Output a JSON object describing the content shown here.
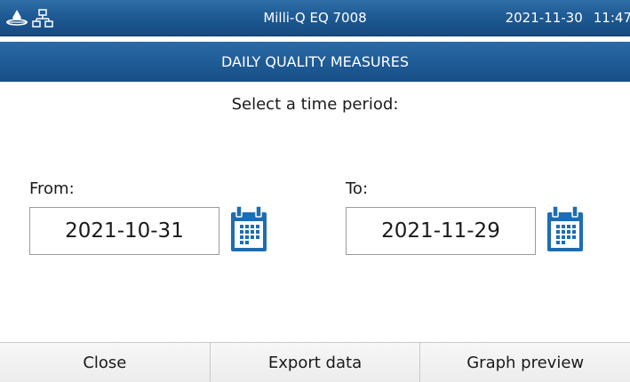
{
  "statusbar": {
    "device_name": "Milli-Q EQ 7008",
    "date": "2021-11-30",
    "time": "11:47",
    "icons": [
      "water-drop-icon",
      "network-icon"
    ]
  },
  "screen_title": "DAILY QUALITY MEASURES",
  "prompt": "Select a time period:",
  "from": {
    "label": "From:",
    "value": "2021-10-31",
    "icon": "calendar-icon"
  },
  "to": {
    "label": "To:",
    "value": "2021-11-29",
    "icon": "calendar-icon"
  },
  "buttons": {
    "close": "Close",
    "export": "Export data",
    "graph": "Graph preview"
  },
  "colors": {
    "header_blue": "#1e5a94",
    "calendar_blue": "#1d6db3"
  }
}
